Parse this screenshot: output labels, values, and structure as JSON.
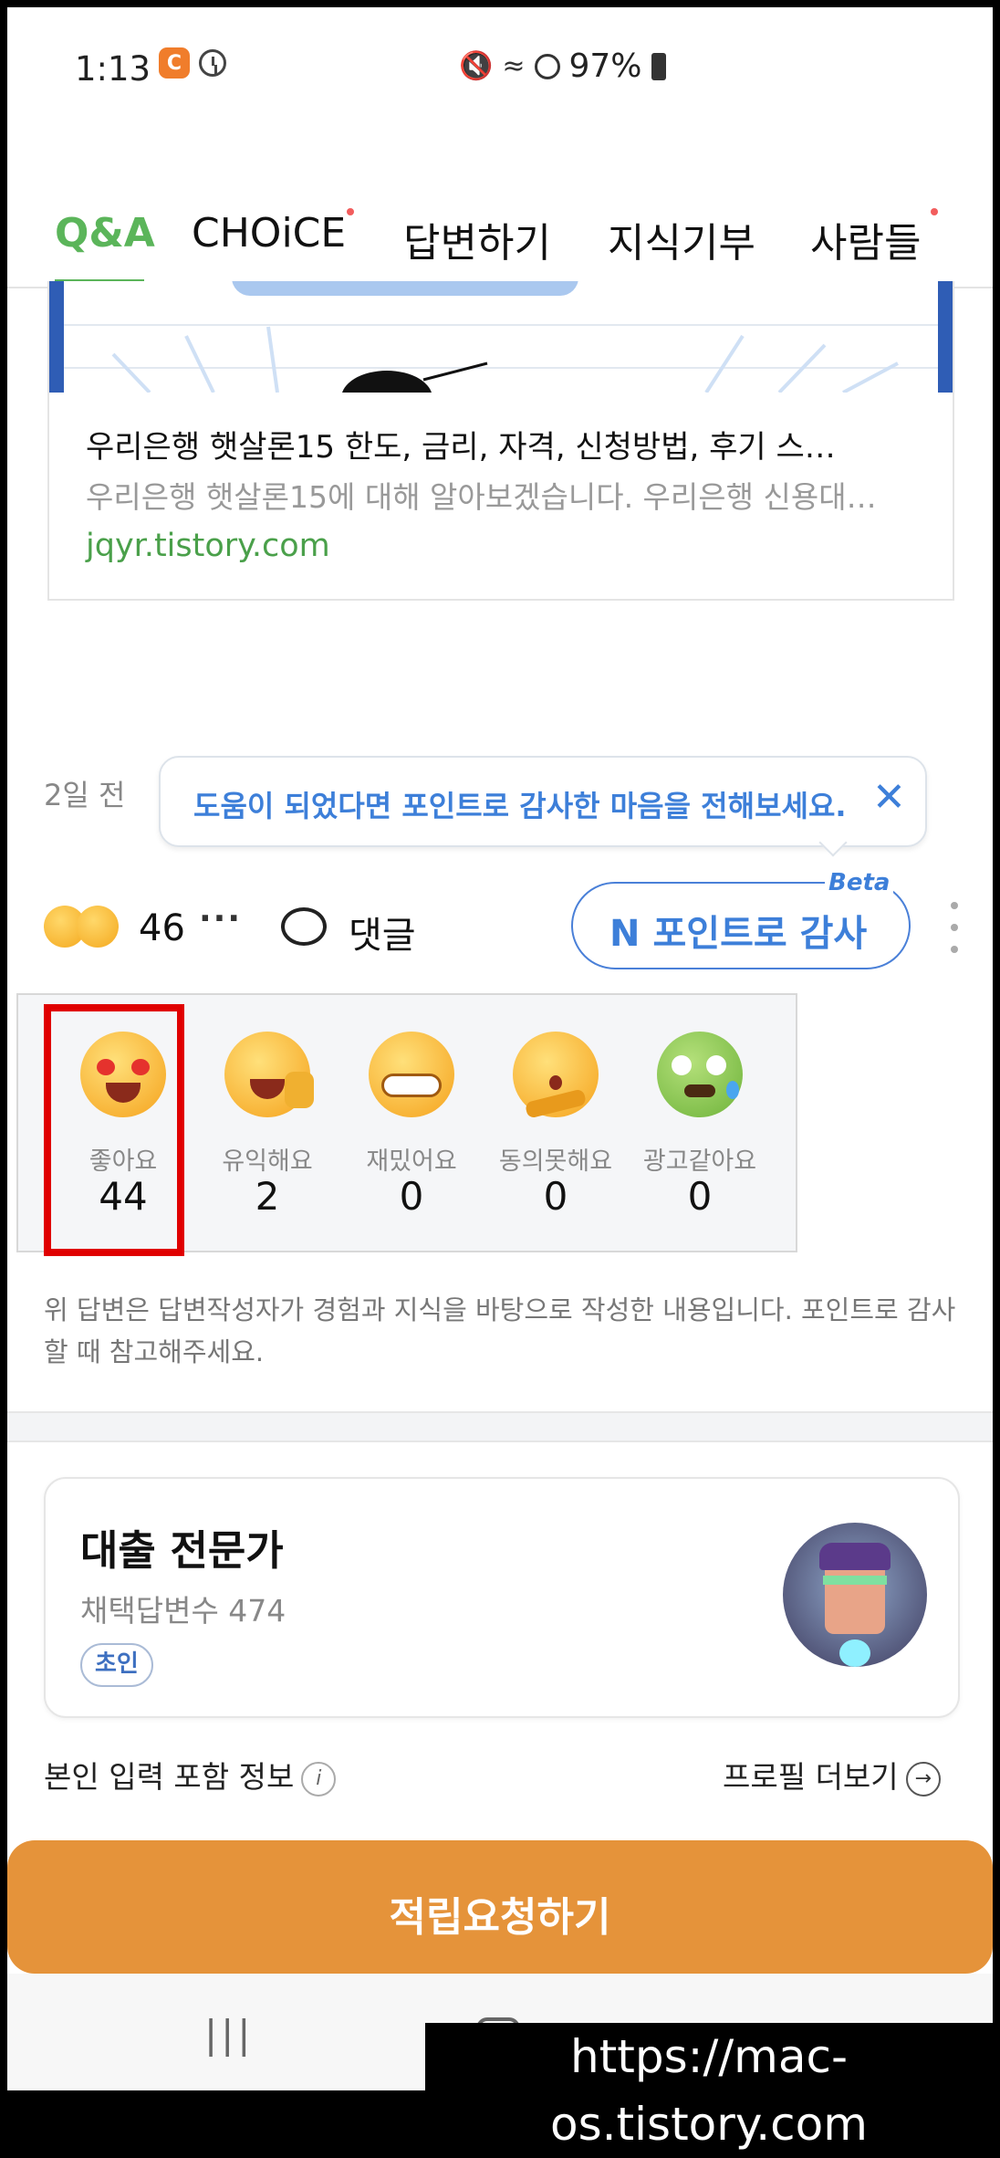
{
  "status_bar": {
    "time": "1:13",
    "battery": "97%"
  },
  "tabs": [
    {
      "label": "Q&A"
    },
    {
      "label": "CHOiCE"
    },
    {
      "label": "답변하기"
    },
    {
      "label": "지식기부"
    },
    {
      "label": "사람들"
    }
  ],
  "link_card": {
    "title": "우리은행 햇살론15 한도, 금리, 자격, 신청방법, 후기 스…",
    "description": "우리은행 햇살론15에 대해 알아보겠습니다. 우리은행 신용대…",
    "domain": "jqyr.tistory.com"
  },
  "answer_meta": {
    "time_ago": "2일 전"
  },
  "tooltip": {
    "text": "도움이 되었다면 포인트로 감사한 마음을 전해보세요.",
    "close_icon": "close-icon"
  },
  "reaction_bar": {
    "count": "46",
    "more": "···",
    "comment_label": "댓글",
    "point_button_label": "포인트로 감사",
    "point_icon": "N",
    "beta_label": "Beta"
  },
  "reactions": [
    {
      "name": "좋아요",
      "count": "44"
    },
    {
      "name": "유익해요",
      "count": "2"
    },
    {
      "name": "재밌어요",
      "count": "0"
    },
    {
      "name": "동의못해요",
      "count": "0"
    },
    {
      "name": "광고같아요",
      "count": "0"
    }
  ],
  "disclaimer": "위 답변은 답변작성자가 경험과 지식을 바탕으로 작성한 내용입니다. 포인트로 감사할 때 참고해주세요.",
  "profile": {
    "name": "대출 전문가",
    "adopted_count": "채택답변수 474",
    "badge": "초인"
  },
  "info_links": {
    "self_info": "본인 입력 포함 정보",
    "info_icon": "i",
    "profile_more": "프로필 더보기",
    "arrow_icon": "→"
  },
  "cta": {
    "label": "적립요청하기"
  },
  "nav": {
    "recent": "|||",
    "back": "<"
  },
  "watermark": "https://mac-os.tistory.com"
}
